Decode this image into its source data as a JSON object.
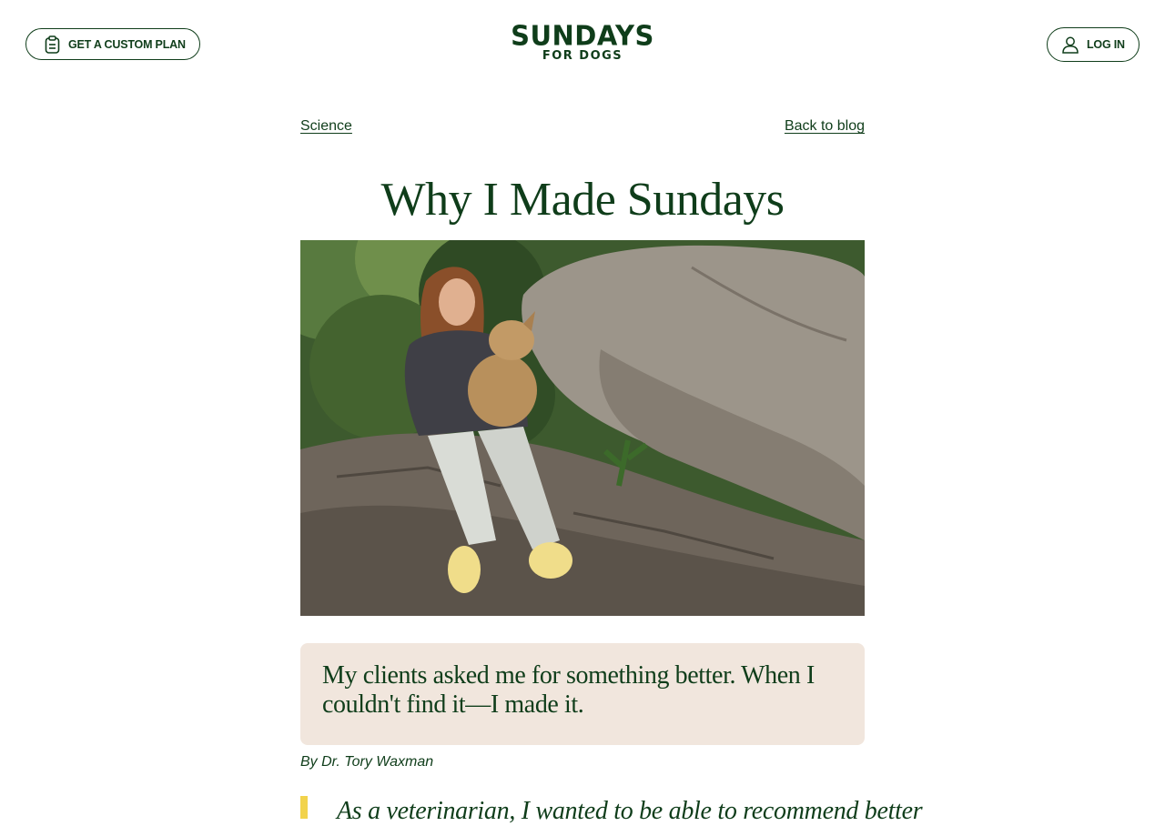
{
  "header": {
    "plan_button": {
      "label": "GET A CUSTOM PLAN",
      "icon": "clipboard-icon"
    },
    "logo": {
      "line1": "SUNDAYS",
      "line2": "FOR DOGS"
    },
    "login_button": {
      "label": "LOG IN",
      "icon": "user-icon"
    }
  },
  "breadcrumb": {
    "category": "Science",
    "back": "Back to blog"
  },
  "article": {
    "title": "Why I Made Sundays",
    "hero_image": "woman-with-dog-on-rocks-photo",
    "quote": "My clients asked me for something better. When I couldn't find it—I made it.",
    "byline": "By Dr. Tory Waxman",
    "pull_quote": "As a veterinarian, I wanted to be able to recommend better"
  },
  "colors": {
    "brand_green": "#0f3d1a",
    "quote_bg": "#f1e6dd",
    "accent_yellow": "#f2d34c"
  }
}
